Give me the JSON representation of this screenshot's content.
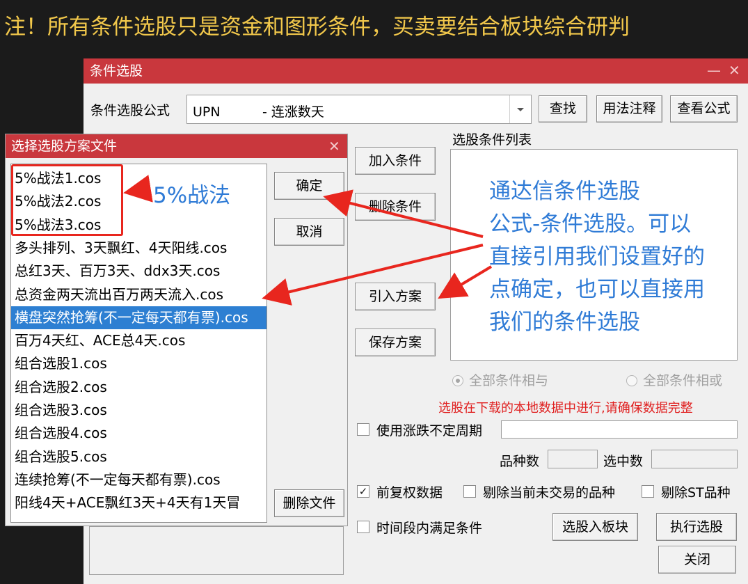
{
  "notice": "注！所有条件选股只是资金和图形条件，买卖要结合板块综合研判",
  "main_window": {
    "title": "条件选股",
    "minimize_glyph": "—",
    "close_glyph": "✕",
    "formula_label": "条件选股公式",
    "formula_value": "UPN          - 连涨数天",
    "find_button": "查找",
    "usage_button": "用法注释",
    "view_formula_button": "查看公式",
    "condition_list_label": "选股条件列表",
    "add_condition_button": "加入条件",
    "delete_condition_button": "删除条件",
    "import_plan_button": "引入方案",
    "save_plan_button": "保存方案",
    "radio_and": "全部条件相与",
    "radio_or": "全部条件相或",
    "warning_text": "选股在下载的本地数据中进行,请确保数据完整",
    "variable_period_label": "使用涨跌不定周期",
    "stock_count_label": "品种数",
    "selected_count_label": "选中数",
    "adjusted_data_label": "前复权数据",
    "exclude_untraded_label": "剔除当前未交易的品种",
    "exclude_st_label": "剔除ST品种",
    "period_condition_label": "时间段内满足条件",
    "add_to_block_button": "选股入板块",
    "execute_button": "执行选股",
    "close_button": "关闭",
    "checks": {
      "variable_period": false,
      "adjusted_data": true,
      "exclude_untraded": false,
      "exclude_st": false,
      "period_condition": false
    }
  },
  "file_dialog": {
    "title": "选择选股方案文件",
    "close_glyph": "✕",
    "ok_button": "确定",
    "cancel_button": "取消",
    "delete_file_button": "删除文件",
    "selected_index": 6,
    "files": [
      "5%战法1.cos",
      "5%战法2.cos",
      "5%战法3.cos",
      "多头排列、3天飘红、4天阳线.cos",
      "总红3天、百万3天、ddx3天.cos",
      "总资金两天流出百万两天流入.cos",
      "横盘突然抢筹(不一定每天都有票).cos",
      "百万4天红、ACE总4天.cos",
      "组合选股1.cos",
      "组合选股2.cos",
      "组合选股3.cos",
      "组合选股4.cos",
      "组合选股5.cos",
      "连续抢筹(不一定每天都有票).cos",
      "阳线4天+ACE飘红3天+4天有1天冒"
    ]
  },
  "annotations": {
    "tag_5pct": "5%战法",
    "explain_lines": [
      "通达信条件选股",
      "公式-条件选股。可以",
      "直接引用我们设置好的",
      "点确定，也可以直接用",
      "我们的条件选股"
    ],
    "accent_color": "#2f7bd6",
    "arrow_color": "#e8261e"
  },
  "colors": {
    "titlebar": "#c9373d",
    "selection": "#2d7fd2",
    "notice": "#f2c84b",
    "warning": "#e02020"
  }
}
